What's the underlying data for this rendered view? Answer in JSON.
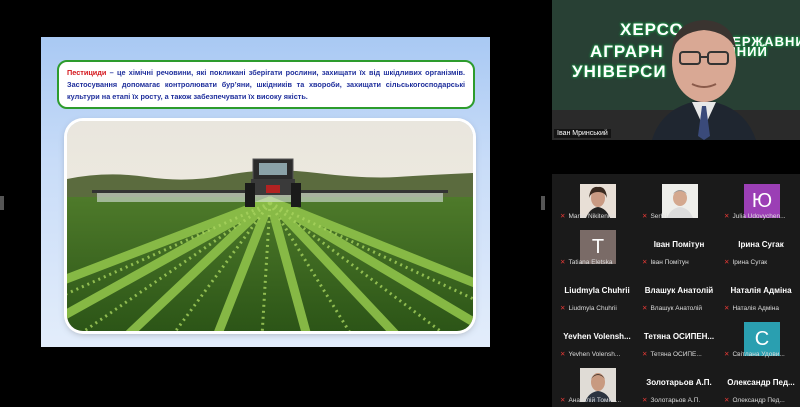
{
  "slide": {
    "keyword": "Пестициди",
    "text": " – це хімічні речовини, які покликані зберігати рослини, захищати їх від шкідливих організмів. Застосування допомагає контролювати бур’яни, шкідників та хвороби, захищати сільськогосподарські культури на етапі їх росту, а також забезпечувати їх високу якість."
  },
  "speaker": {
    "name": "Іван Мринський",
    "banner_lines": [
      "ХЕРСО",
      "ДЕРЖАВНИ",
      "АГРАРН",
      "ІЧНИЙ",
      "УНІВЕРСИ"
    ]
  },
  "participants": [
    {
      "label": "Mariia Nikitenko",
      "title": "",
      "avatar_type": "photo",
      "avatar_color": "#c9b7a6",
      "avatar_letter": ""
    },
    {
      "label": "Serhii Zaiets",
      "title": "",
      "avatar_type": "photo",
      "avatar_color": "#d8d2c6",
      "avatar_letter": ""
    },
    {
      "label": "Julia Udovychen...",
      "title": "",
      "avatar_type": "letter",
      "avatar_color": "#9b3fb5",
      "avatar_letter": "Ю"
    },
    {
      "label": "Tatiana Eletska",
      "title": "",
      "avatar_type": "letter",
      "avatar_color": "#7a6b67",
      "avatar_letter": "Т"
    },
    {
      "label": "Іван Помітун",
      "title": "Іван Помітун",
      "avatar_type": "none",
      "avatar_color": "",
      "avatar_letter": ""
    },
    {
      "label": "Ірина Сугак",
      "title": "Ірина Сугак",
      "avatar_type": "none",
      "avatar_color": "",
      "avatar_letter": ""
    },
    {
      "label": "Liudmyla Chuhrii",
      "title": "Liudmyla Chuhrii",
      "avatar_type": "none",
      "avatar_color": "",
      "avatar_letter": ""
    },
    {
      "label": "Влашук Анатолій",
      "title": "Влашук Анатолій",
      "avatar_type": "none",
      "avatar_color": "",
      "avatar_letter": ""
    },
    {
      "label": "Наталія Адміна",
      "title": "Наталія Адміна",
      "avatar_type": "none",
      "avatar_color": "",
      "avatar_letter": ""
    },
    {
      "label": "Yevhen Volensh...",
      "title": "Yevhen Volensh...",
      "avatar_type": "none",
      "avatar_color": "",
      "avatar_letter": ""
    },
    {
      "label": "Тетяна ОСИПЕ...",
      "title": "Тетяна ОСИПЕН...",
      "avatar_type": "none",
      "avatar_color": "",
      "avatar_letter": ""
    },
    {
      "label": "Світлана Удови...",
      "title": "",
      "avatar_type": "letter",
      "avatar_color": "#2a9fb0",
      "avatar_letter": "С"
    },
    {
      "label": "Анатолій Томни...",
      "title": "",
      "avatar_type": "photo",
      "avatar_color": "#8a7a6a",
      "avatar_letter": ""
    },
    {
      "label": "Золотарьов А.П.",
      "title": "Золотарьов А.П.",
      "avatar_type": "none",
      "avatar_color": "",
      "avatar_letter": ""
    },
    {
      "label": "Олександр Пед...",
      "title": "Олександр Пед...",
      "avatar_type": "none",
      "avatar_color": "",
      "avatar_letter": ""
    }
  ]
}
